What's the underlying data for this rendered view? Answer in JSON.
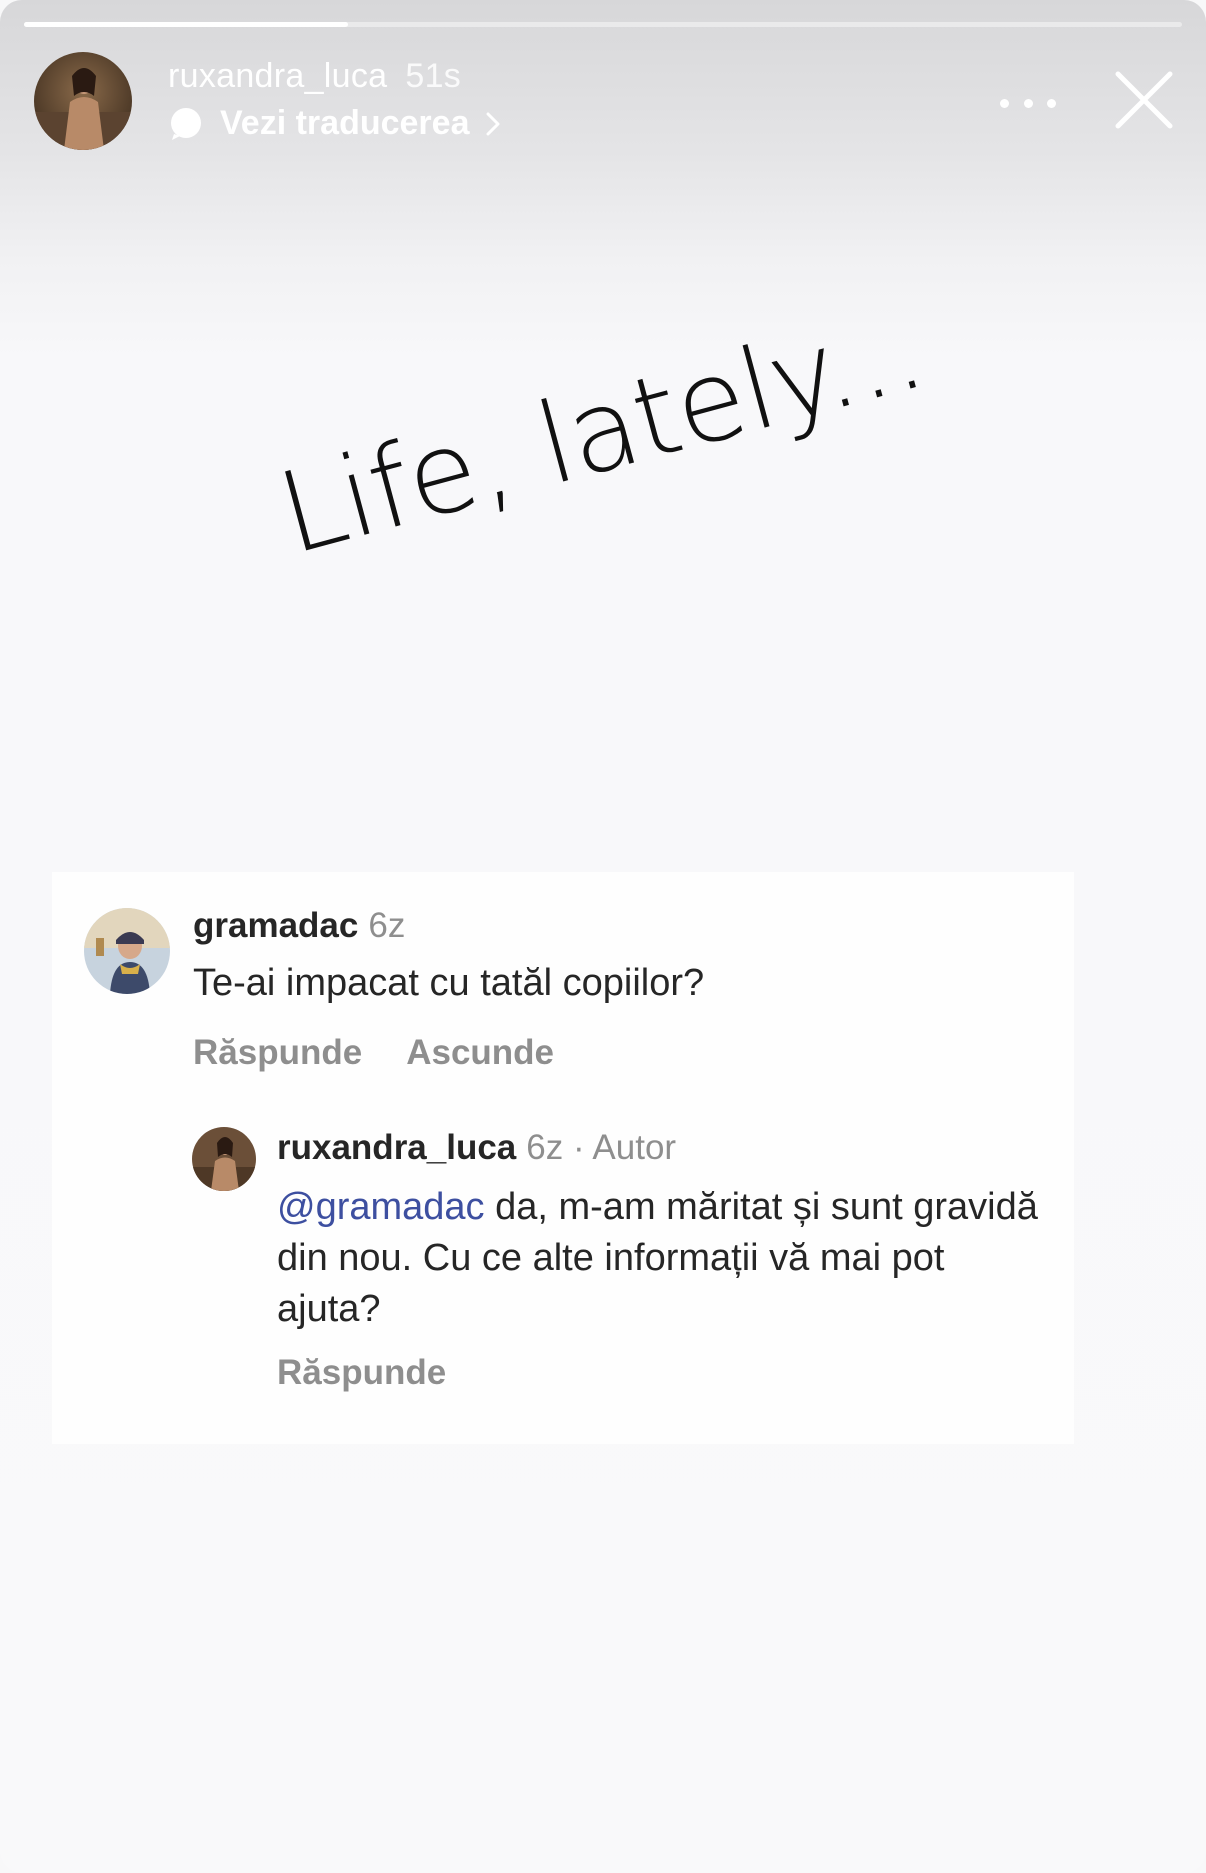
{
  "story": {
    "progress_fraction": 0.28
  },
  "header": {
    "username": "ruxandra_luca",
    "time_ago": "51s",
    "translate_label": "Vezi traducerea",
    "icons": [
      "avatar",
      "translate-bubble-icon",
      "chevron-right-icon",
      "more-dots-icon",
      "close-icon"
    ]
  },
  "story_text": {
    "title": "Life, lately..."
  },
  "comments": {
    "first": {
      "username": "gramadac",
      "time_ago": "6z",
      "text": "Te-ai impacat cu tatăl copiilor?",
      "reply_label": "Răspunde",
      "hide_label": "Ascunde"
    },
    "reply": {
      "username": "ruxandra_luca",
      "meta": "6z · Autor",
      "mention": "@gramadac",
      "text": " da, m-am măritat și sunt gravidă din nou. Cu ce alte informații vă mai pot ajuta?",
      "reply_label": "Răspunde"
    }
  },
  "colors": {
    "mention": "#3d4fa0",
    "secondary_text": "#8e8e8e",
    "primary_text": "#262626"
  }
}
